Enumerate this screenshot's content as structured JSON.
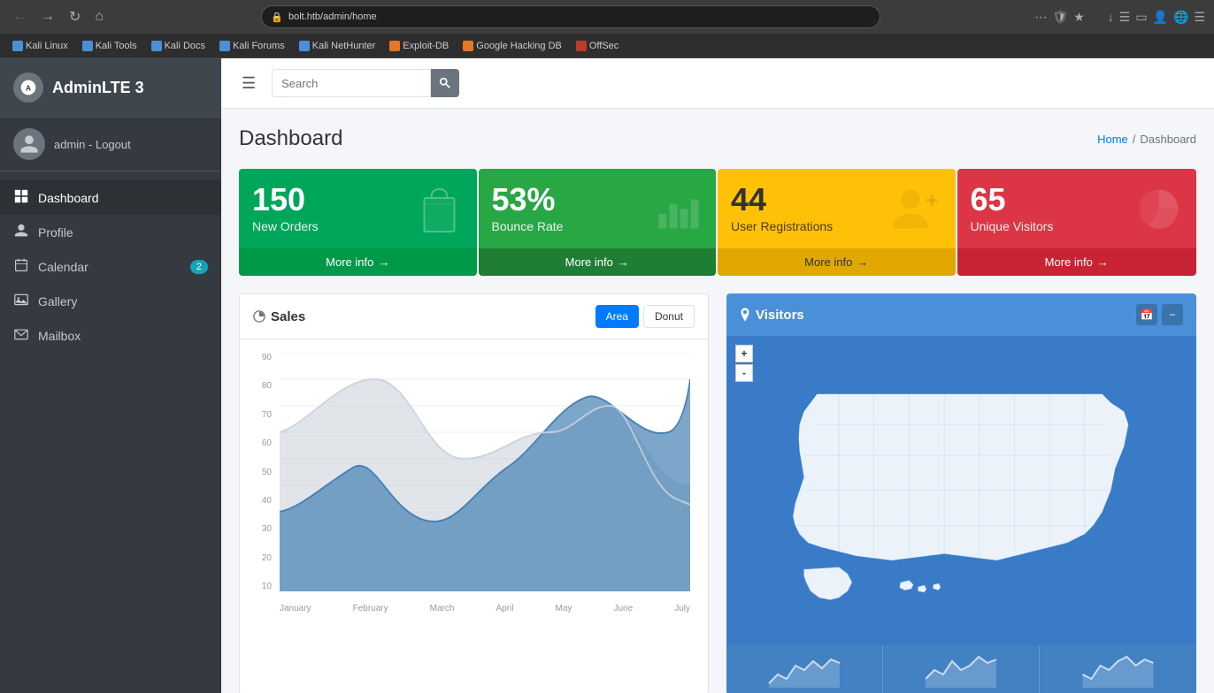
{
  "browser": {
    "url": "bolt.htb/admin/home",
    "back_disabled": false,
    "forward_disabled": false
  },
  "bookmarks": [
    {
      "label": "Kali Linux",
      "color": "#4a90d9"
    },
    {
      "label": "Kali Tools",
      "color": "#4a90d9"
    },
    {
      "label": "Kali Docs",
      "color": "#4a90d9"
    },
    {
      "label": "Kali Forums",
      "color": "#4a90d9"
    },
    {
      "label": "Kali NetHunter",
      "color": "#4a90d9"
    },
    {
      "label": "Exploit-DB",
      "color": "#e87722"
    },
    {
      "label": "Google Hacking DB",
      "color": "#e87722"
    },
    {
      "label": "OffSec",
      "color": "#c0392b"
    }
  ],
  "sidebar": {
    "brand": "AdminLTE 3",
    "user": "admin - Logout",
    "items": [
      {
        "label": "Dashboard",
        "icon": "⊞",
        "active": true
      },
      {
        "label": "Profile",
        "icon": "👤",
        "active": false
      },
      {
        "label": "Calendar",
        "icon": "📅",
        "badge": "2",
        "active": false
      },
      {
        "label": "Gallery",
        "icon": "🖼",
        "active": false
      },
      {
        "label": "Mailbox",
        "icon": "✉",
        "active": false
      }
    ]
  },
  "navbar": {
    "search_placeholder": "Search"
  },
  "content": {
    "title": "Dashboard",
    "breadcrumb": [
      "Home",
      "Dashboard"
    ]
  },
  "info_boxes": [
    {
      "number": "150",
      "label": "New Orders",
      "footer": "More info",
      "color": "teal",
      "icon": "bag"
    },
    {
      "number": "53%",
      "label": "Bounce Rate",
      "footer": "More info",
      "color": "green",
      "icon": "chart"
    },
    {
      "number": "44",
      "label": "User Registrations",
      "footer": "More info",
      "color": "yellow",
      "icon": "user-plus"
    },
    {
      "number": "65",
      "label": "Unique Visitors",
      "footer": "More info",
      "color": "red",
      "icon": "pie"
    }
  ],
  "sales_chart": {
    "title": "Sales",
    "btn_area": "Area",
    "btn_donut": "Donut",
    "y_labels": [
      "90",
      "80",
      "70",
      "60",
      "50",
      "40",
      "30",
      "20",
      "10"
    ],
    "x_labels": [
      "January",
      "February",
      "March",
      "April",
      "May",
      "June",
      "July"
    ]
  },
  "visitors": {
    "title": "Visitors",
    "footer_stats": [
      "",
      "",
      ""
    ]
  }
}
